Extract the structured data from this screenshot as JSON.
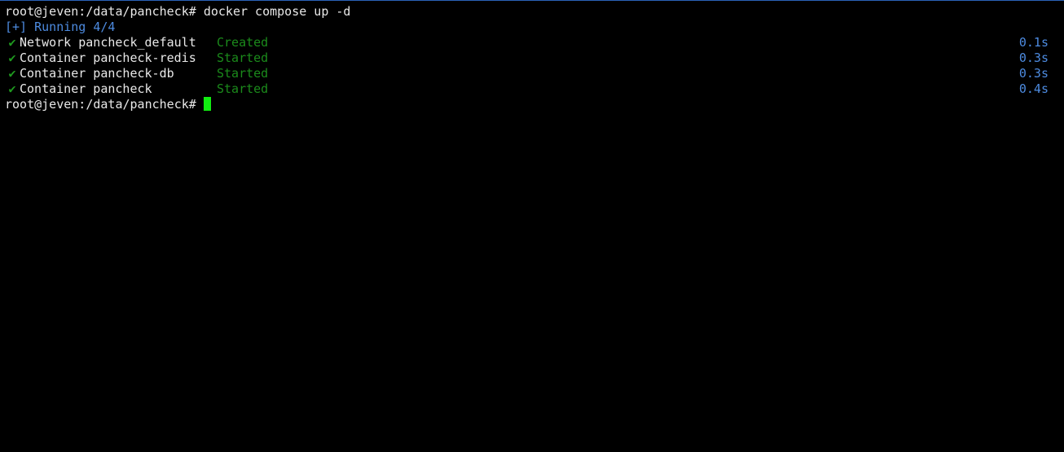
{
  "terminal": {
    "prompt_1": "root@jeven:/data/pancheck#",
    "command_1": "docker compose up -d",
    "running": "[+] Running 4/4",
    "check_symbol": "✔",
    "resources": [
      {
        "name": "Network pancheck_default",
        "status": "Created",
        "time": "0.1s"
      },
      {
        "name": "Container pancheck-redis",
        "status": "Started",
        "time": "0.3s"
      },
      {
        "name": "Container pancheck-db",
        "status": "Started",
        "time": "0.3s"
      },
      {
        "name": "Container pancheck",
        "status": "Started",
        "time": "0.4s"
      }
    ],
    "prompt_2": "root@jeven:/data/pancheck#"
  },
  "colors": {
    "background": "#000000",
    "text": "#e8e8e8",
    "running_blue": "#4d8be0",
    "status_green": "#1b8a1b",
    "cursor_green": "#11ee11",
    "top_border": "#2a62b8"
  }
}
